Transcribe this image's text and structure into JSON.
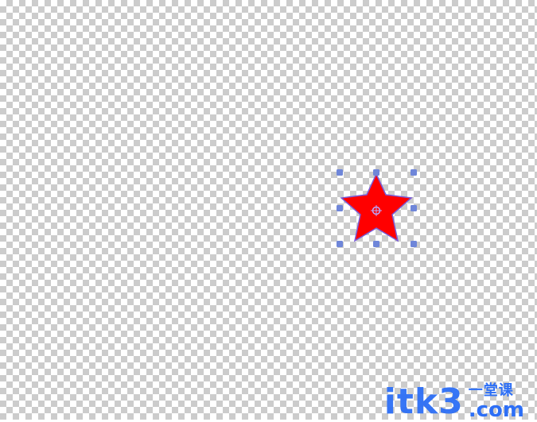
{
  "canvas": {
    "pattern": "transparent-checkerboard",
    "checker_color": "#cccccc",
    "base_color": "#ffffff"
  },
  "shape": {
    "type": "star",
    "points": 5,
    "fill": "#ff0000",
    "stroke": "#7a5bd6",
    "selected": true,
    "handle_color": "#6f86d9",
    "center_marker": "rotation-center-icon"
  },
  "watermark": {
    "main": "itk3",
    "cn": "一堂课",
    "com": ".com",
    "color": "#2d6ff6"
  }
}
